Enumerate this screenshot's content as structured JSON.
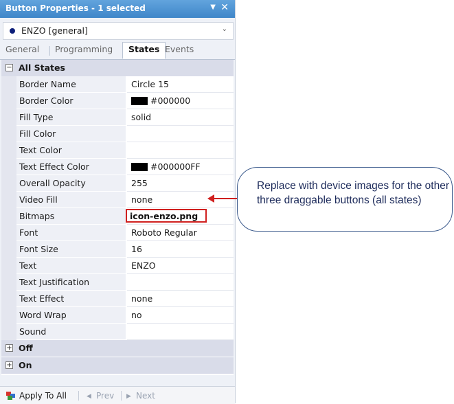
{
  "window": {
    "title": "Button Properties - 1 selected",
    "dropdown_glyph": "▼",
    "close_glyph": "✕"
  },
  "object_selector": {
    "value": "ENZO  [general]",
    "chevron": "⌄"
  },
  "tabs": [
    {
      "label": "General",
      "active": false
    },
    {
      "label": "Programming",
      "active": false
    },
    {
      "label": "States",
      "active": true
    },
    {
      "label": "Events",
      "active": false
    }
  ],
  "sections": {
    "all_states": {
      "label": "All States",
      "toggle": "−"
    },
    "off": {
      "label": "Off",
      "toggle": "+"
    },
    "on": {
      "label": "On",
      "toggle": "+"
    }
  },
  "properties": [
    {
      "name": "Border Name",
      "value": "Circle 15"
    },
    {
      "name": "Border Color",
      "value": "#000000",
      "swatch": "#000000"
    },
    {
      "name": "Fill Type",
      "value": "solid"
    },
    {
      "name": "Fill Color",
      "value": ""
    },
    {
      "name": "Text Color",
      "value": ""
    },
    {
      "name": "Text Effect Color",
      "value": "#000000FF",
      "swatch": "#000000"
    },
    {
      "name": "Overall Opacity",
      "value": "255"
    },
    {
      "name": "Video Fill",
      "value": "none"
    },
    {
      "name": "Bitmaps",
      "value": "icon-enzo.png",
      "highlighted": true
    },
    {
      "name": "Font",
      "value": "Roboto Regular"
    },
    {
      "name": "Font Size",
      "value": "16"
    },
    {
      "name": "Text",
      "value": "ENZO"
    },
    {
      "name": "Text Justification",
      "value": ""
    },
    {
      "name": "Text Effect",
      "value": "none"
    },
    {
      "name": "Word Wrap",
      "value": "no"
    },
    {
      "name": "Sound",
      "value": ""
    }
  ],
  "bottom_bar": {
    "apply_label": "Apply To All",
    "prev_label": "Prev",
    "next_label": "Next"
  },
  "callout": {
    "text": "Replace with device images for the other three draggable buttons (all states)"
  },
  "colors": {
    "title_bar": "#4a90d2",
    "highlight": "#d0201f",
    "callout_border": "#3b5a8c",
    "section_bg": "#d9dce9"
  }
}
